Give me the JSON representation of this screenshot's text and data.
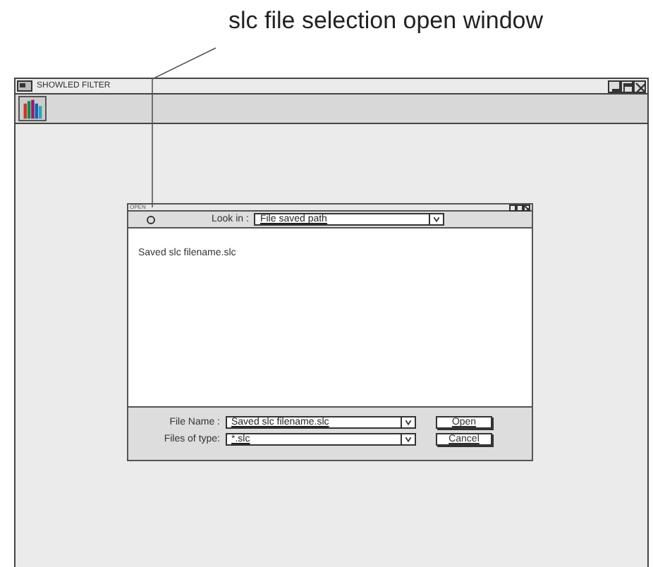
{
  "annotation": {
    "text": "slc file selection open window"
  },
  "window": {
    "title": "SHOWLED FILTER"
  },
  "dialog": {
    "title": "OPEN",
    "look_in": {
      "label": "Look in :",
      "value": "File saved path"
    },
    "files": [
      "Saved slc filename.slc"
    ],
    "file_name": {
      "label": "File Name :",
      "value": "Saved slc filename.slc"
    },
    "file_type": {
      "label": "Files of type:",
      "value": "*.slc"
    },
    "buttons": [
      "Open",
      "Cancel"
    ]
  }
}
